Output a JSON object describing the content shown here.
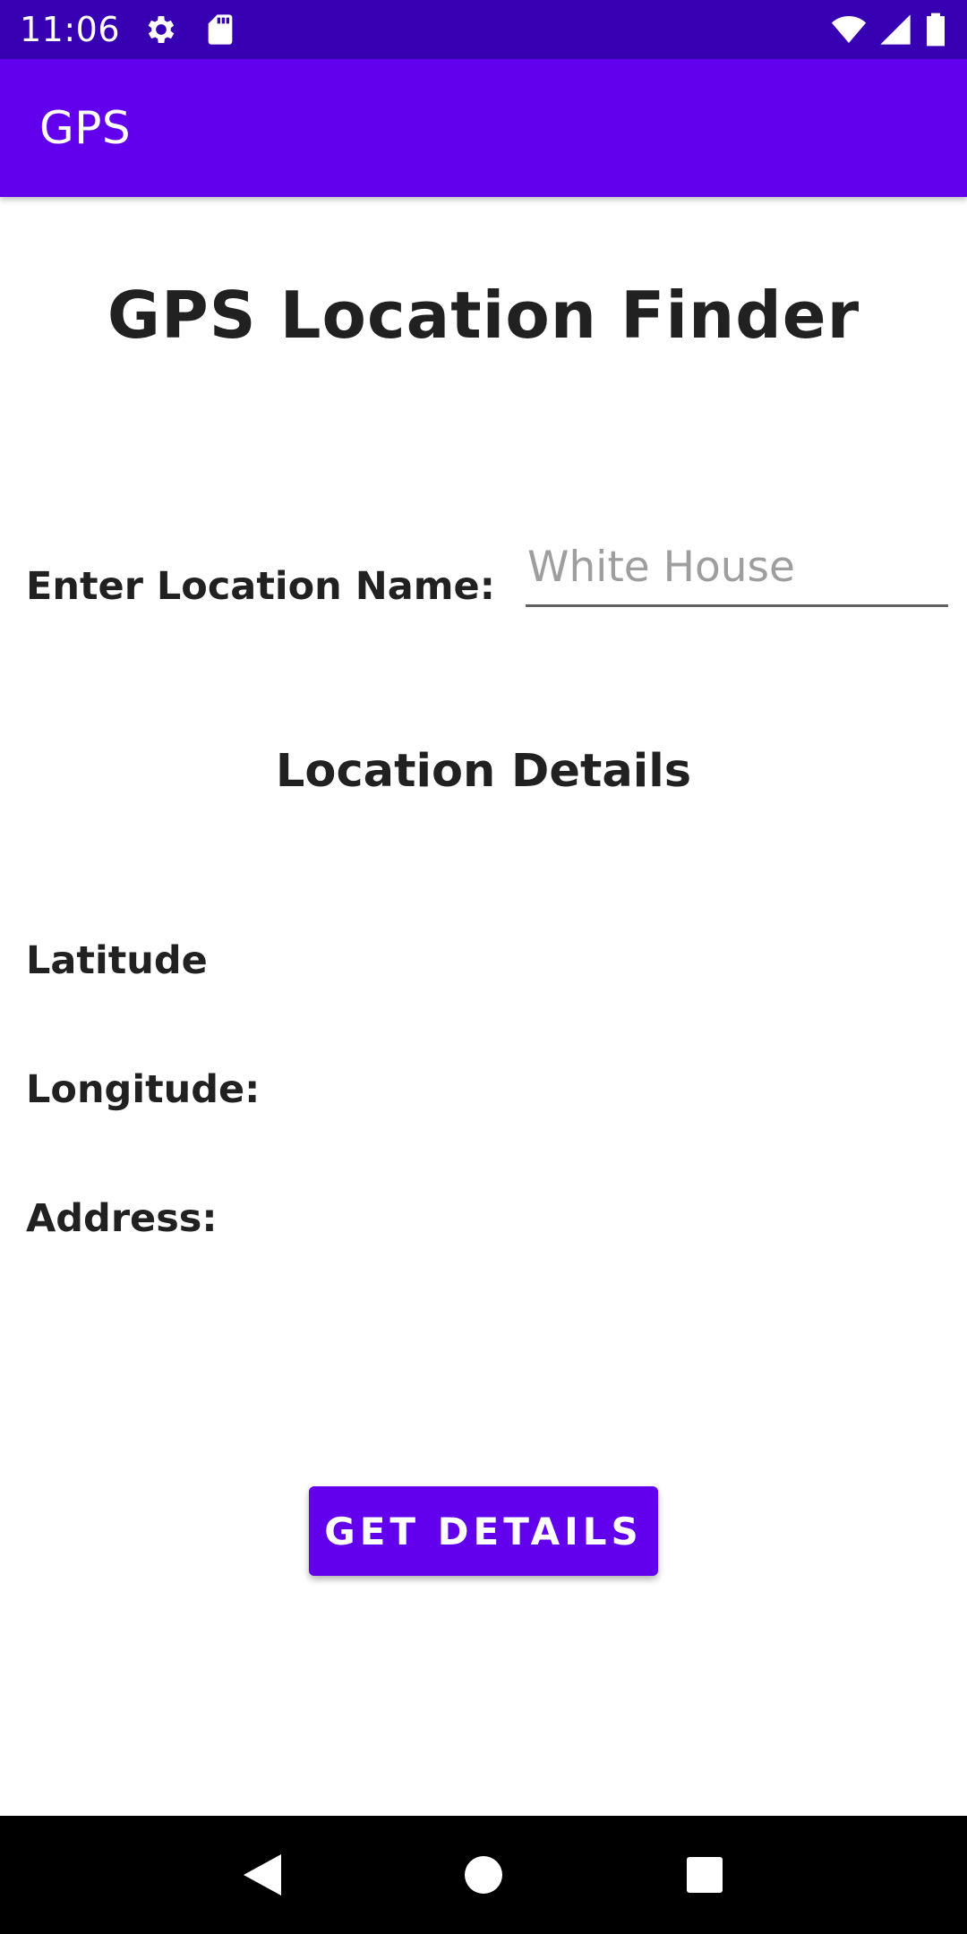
{
  "status_bar": {
    "time": "11:06",
    "icons": [
      "settings-icon",
      "sd-card-icon",
      "wifi-icon",
      "signal-icon",
      "battery-icon"
    ]
  },
  "app_bar": {
    "title": "GPS"
  },
  "main": {
    "heading": "GPS Location Finder",
    "location_label": "Enter Location Name:",
    "location_input": {
      "placeholder": "White House",
      "value": ""
    },
    "details_heading": "Location Details",
    "latitude_label": "Latitude",
    "longitude_label": "Longitude:",
    "address_label": "Address:",
    "get_details_button": "GET DETAILS"
  },
  "nav_bar": {
    "icons": [
      "back-icon",
      "home-icon",
      "recents-icon"
    ]
  },
  "colors": {
    "status_bar": "#3700b3",
    "primary": "#6200ee",
    "text": "#212121",
    "hint": "#9e9e9e"
  }
}
